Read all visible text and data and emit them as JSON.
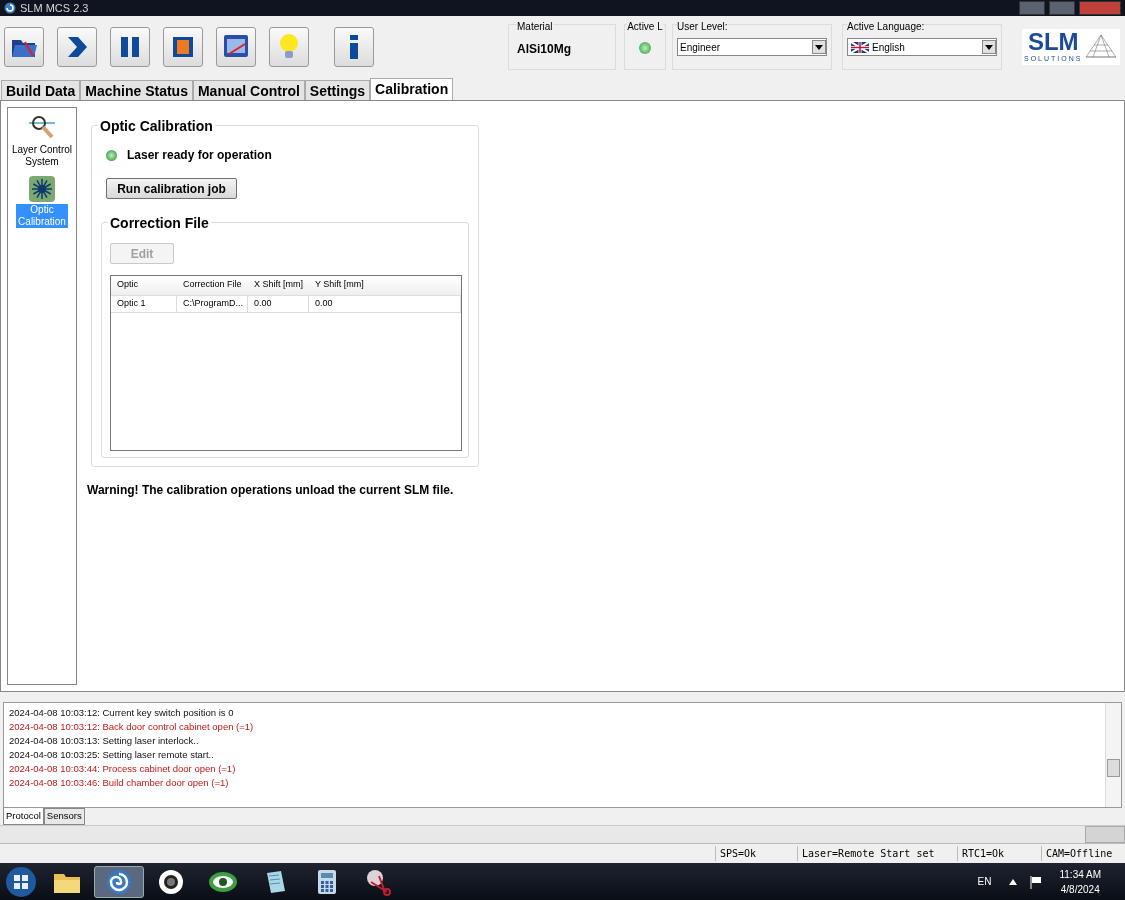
{
  "window": {
    "title": "SLM MCS 2.3"
  },
  "toolbar": {
    "buttons": [
      {
        "kind": "open"
      },
      {
        "kind": "start"
      },
      {
        "kind": "pause"
      },
      {
        "kind": "stop"
      },
      {
        "kind": "screen"
      },
      {
        "kind": "light"
      },
      {
        "kind": "info"
      }
    ],
    "material": {
      "label": "Material",
      "value": "AlSi10Mg"
    },
    "active_laser": {
      "label": "Active L",
      "on": true
    },
    "user_level": {
      "label": "User Level:",
      "value": "Engineer"
    },
    "language": {
      "label": "Active Language:",
      "value": "English"
    },
    "logo": {
      "name": "SLM",
      "tagline": "SOLUTIONS"
    }
  },
  "tabs": [
    {
      "label": "Build Data",
      "selected": false
    },
    {
      "label": "Machine Status",
      "selected": false
    },
    {
      "label": "Manual Control",
      "selected": false
    },
    {
      "label": "Settings",
      "selected": false
    },
    {
      "label": "Calibration",
      "selected": true
    }
  ],
  "sidebar": {
    "items": [
      {
        "kind": "lens",
        "label": "Layer Control System",
        "selected": false
      },
      {
        "kind": "laser",
        "label": "Optic Calibration",
        "selected": true
      }
    ]
  },
  "optic_calibration": {
    "title": "Optic Calibration",
    "status": {
      "text": "Laser ready for operation",
      "on": true
    },
    "run_button": "Run calibration job",
    "correction_file": {
      "title": "Correction File",
      "edit_button": {
        "label": "Edit",
        "disabled": true
      },
      "table": {
        "columns": [
          "Optic",
          "Correction File",
          "X Shift [mm]",
          "Y Shift [mm]"
        ],
        "rows": [
          [
            "Optic 1",
            "C:\\ProgramD...",
            "0.00",
            "0.00"
          ]
        ]
      }
    }
  },
  "warning": "Warning! The calibration operations unload the current SLM file.",
  "log": {
    "lines": [
      {
        "kind": "info",
        "text": "2024-04-08 10:03:12: Current key switch position is 0"
      },
      {
        "kind": "error",
        "text": "2024-04-08 10:03:12: Back door control cabinet open (=1)"
      },
      {
        "kind": "info",
        "text": "2024-04-08 10:03:13: Setting laser interlock.."
      },
      {
        "kind": "info",
        "text": "2024-04-08 10:03:25: Setting laser remote start.."
      },
      {
        "kind": "error",
        "text": "2024-04-08 10:03:44: Process cabinet door open (=1)"
      },
      {
        "kind": "error",
        "text": "2024-04-08 10:03:46: Build chamber door open (=1)"
      }
    ],
    "tabs": [
      {
        "label": "Protocol",
        "selected": true
      },
      {
        "label": "Sensors",
        "selected": false
      }
    ]
  },
  "status_bar": [
    "SPS=Ok",
    "Laser=Remote Start set",
    "RTC1=Ok",
    "CAM=Offline"
  ],
  "taskbar": {
    "apps": [
      {
        "kind": "folder",
        "selected": false
      },
      {
        "kind": "spiral",
        "selected": true
      },
      {
        "kind": "camera",
        "selected": false
      },
      {
        "kind": "eye",
        "selected": false
      },
      {
        "kind": "note",
        "selected": false
      },
      {
        "kind": "calculator",
        "selected": false
      },
      {
        "kind": "scissors",
        "selected": false
      }
    ],
    "language": "EN",
    "time": "11:34 AM",
    "date": "4/8/2024"
  }
}
